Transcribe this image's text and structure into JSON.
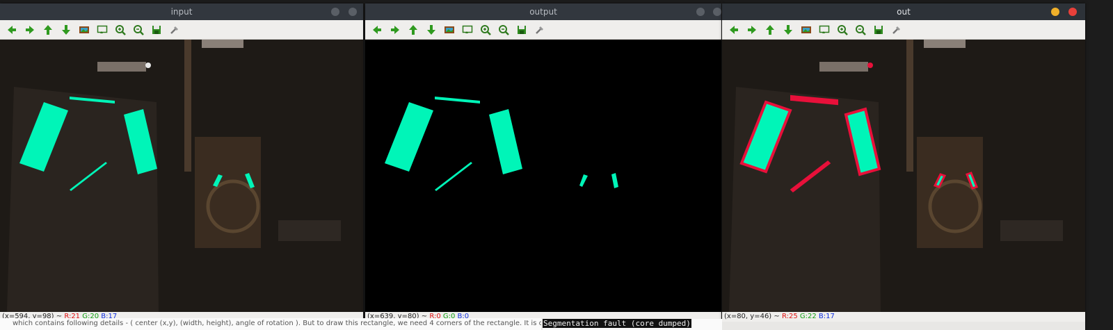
{
  "windows": [
    {
      "id": "input",
      "title": "input",
      "status": {
        "coords": "(x=594, y=98) ~",
        "r": "R:21",
        "g": "G:20",
        "b": "B:17"
      }
    },
    {
      "id": "output",
      "title": "output",
      "status": {
        "coords": "(x=639, y=80) ~",
        "r": "R:0",
        "g": "G:0",
        "b": "B:0"
      }
    },
    {
      "id": "out",
      "title": "out",
      "status": {
        "coords": "(x=80, y=46) ~",
        "r": "R:25",
        "g": "G:22",
        "b": "B:17"
      }
    }
  ],
  "toolbar_icons": [
    "arrow-left-icon",
    "arrow-right-icon",
    "arrow-up-icon",
    "arrow-down-icon",
    "image-icon",
    "zoom-region-icon",
    "zoom-in-icon",
    "zoom-out-icon",
    "save-icon",
    "properties-icon"
  ],
  "background_text": "which contains following details - ( center (x,y), (width, height), angle of rotation ). But to draw this rectangle, we need 4 corners of the rectangle. It is c",
  "terminal_text": "Segmentation fault (core dumped)",
  "colors": {
    "shape_fill": "#00f5b8",
    "outline": "#e8103a",
    "window_close": "#e8403a",
    "window_min": "#f0b02a"
  }
}
